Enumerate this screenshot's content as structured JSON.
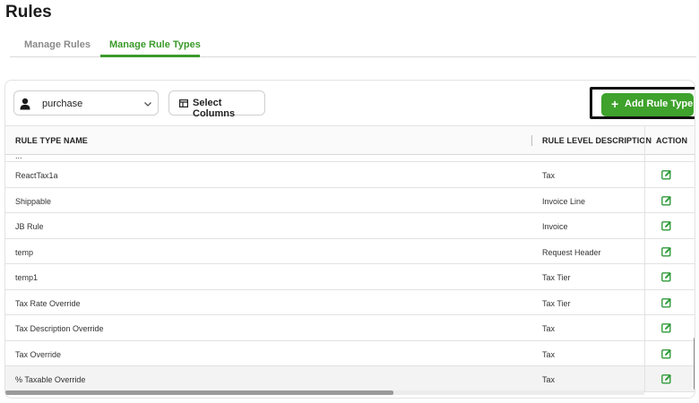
{
  "page": {
    "title": "Rules"
  },
  "tabs": [
    {
      "label": "Manage Rules",
      "active": false
    },
    {
      "label": "Manage Rule Types",
      "active": true
    }
  ],
  "toolbar": {
    "select_value": "purchase",
    "select_columns_label": "Select Columns",
    "add_button_label": "Add Rule Type",
    "add_button_plus": "+"
  },
  "table": {
    "columns": [
      "RULE TYPE NAME",
      "RULE LEVEL DESCRIPTION",
      "ACTION"
    ],
    "partial_row_text": "...",
    "rows": [
      {
        "name": "ReactTax1a",
        "desc": "Tax"
      },
      {
        "name": "Shippable",
        "desc": "Invoice Line"
      },
      {
        "name": "JB Rule",
        "desc": "Invoice"
      },
      {
        "name": "temp",
        "desc": "Request Header"
      },
      {
        "name": "temp1",
        "desc": "Tax Tier"
      },
      {
        "name": "Tax Rate Override",
        "desc": "Tax Tier"
      },
      {
        "name": "Tax Description Override",
        "desc": "Tax"
      },
      {
        "name": "Tax Override",
        "desc": "Tax"
      },
      {
        "name": "% Taxable Override",
        "desc": "Tax"
      }
    ]
  },
  "colors": {
    "accent": "#3ea22c",
    "tab_active": "#3a9a2a",
    "edit_icon": "#2f9a3a"
  },
  "icons": {
    "select": "user-icon",
    "select_arrow": "chevron-down-icon",
    "columns": "columns-icon",
    "edit": "edit-icon"
  }
}
